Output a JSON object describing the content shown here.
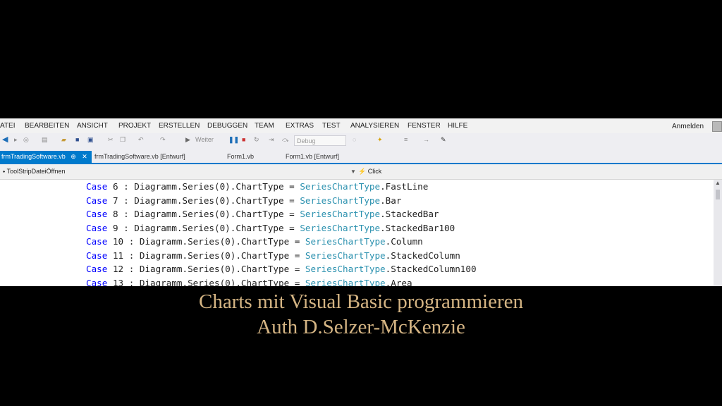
{
  "menu": {
    "items": [
      "ATEI",
      "BEARBEITEN",
      "ANSICHT",
      "PROJEKT",
      "ERSTELLEN",
      "DEBUGGEN",
      "TEAM",
      "EXTRAS",
      "TEST",
      "ANALYSIEREN",
      "FENSTER",
      "HILFE"
    ],
    "login": "Anmelden"
  },
  "toolbar": {
    "continue_label": "Weiter",
    "config": "Debug"
  },
  "tabs": [
    {
      "label": "frmTradingSoftware.vb",
      "pin": "⊕",
      "close": "✕",
      "active": true
    },
    {
      "label": "frmTradingSoftware.vb [Entwurf]",
      "active": false
    },
    {
      "label": "Form1.vb",
      "active": false
    },
    {
      "label": "Form1.vb [Entwurf]",
      "active": false
    }
  ],
  "navbar": {
    "left": "ToolStripDateiÖffnen",
    "right": "Click"
  },
  "code": [
    {
      "num": "6",
      "method": "FastLine"
    },
    {
      "num": "7",
      "method": "Bar"
    },
    {
      "num": "8",
      "method": "StackedBar"
    },
    {
      "num": "9",
      "method": "StackedBar100"
    },
    {
      "num": "10",
      "method": "Column"
    },
    {
      "num": "11",
      "method": "StackedColumn"
    },
    {
      "num": "12",
      "method": "StackedColumn100"
    },
    {
      "num": "13",
      "method": "Area"
    }
  ],
  "code_tokens": {
    "case": "Case",
    "expr": " : Diagramm.Series(0).ChartType = ",
    "type": "SeriesChartType",
    "dot": "."
  },
  "caption": {
    "line1": "Charts mit Visual Basic programmieren",
    "line2": "Auth D.Selzer-McKenzie"
  },
  "colors": {
    "keyword": "#0000ff",
    "type": "#2b91af",
    "tab_active": "#007acc",
    "caption": "#d4b483"
  }
}
